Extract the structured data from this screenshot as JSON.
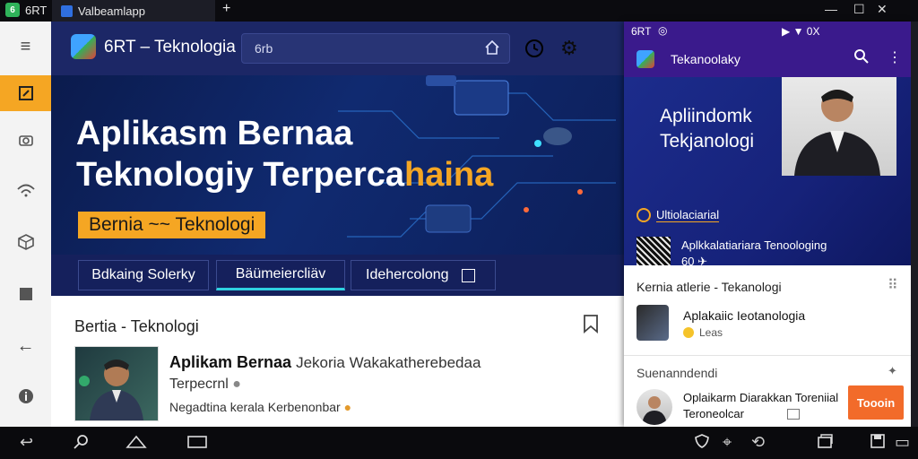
{
  "titlebar": {
    "app_label": "6RT",
    "tab_title": "Valbeamlapp",
    "new_tab": "+",
    "controls": [
      "—",
      "☐",
      "✕"
    ]
  },
  "sidebar": {
    "items": [
      {
        "icon": "menu-icon"
      },
      {
        "icon": "edit-icon",
        "active": true
      },
      {
        "icon": "camera-icon"
      },
      {
        "icon": "wifi-icon"
      },
      {
        "icon": "cube-icon"
      },
      {
        "icon": "square-icon"
      },
      {
        "icon": "back-arrow-icon"
      },
      {
        "icon": "info-icon"
      }
    ]
  },
  "main": {
    "brand": "6RT – Teknologia",
    "search_value": "6rb",
    "hero": {
      "title_line1": "Aplikasm Bernaa",
      "title_line2a": "Teknologiy Terperca",
      "title_line2b": "haina",
      "badge": "Bernia ~~ Teknologi"
    },
    "hero_tabs": [
      "Bdkaing Solerky",
      "Bäümeiercliäv",
      "Idehercolong"
    ],
    "feed": {
      "section_title": "Bertia - Teknologi",
      "article_title_bold": "Aplikam Bernaa",
      "article_title_rest": "Jekoria Wakakatherebedaa",
      "article_line2": "Terpecrnl",
      "article_line3": "Negadtina kerala Kerbenonbar"
    }
  },
  "phone": {
    "status_left": "6RT",
    "status_right": "▶ ▼ 0X",
    "app_title": "Tekanoolaky",
    "hero_title_line1": "Apliindomk",
    "hero_title_line2": "Tekjanologi",
    "hero_label": "Ultiolaciarial",
    "hero_item_title": "Aplkkalatiariara Tenoologing",
    "hero_item_meta": "60 ✈",
    "list_header": "Kernia atlerie - Tekanologi",
    "list_item1_title": "Aplakaiic Ieotanologia",
    "list_item1_meta": "Leas",
    "section2_header": "Suenanndendi",
    "list_item2_title": "Oplaikarm Diarakkan Toreniial",
    "list_item2_sub": "Teroneolcar",
    "orange_button": "Toooin"
  },
  "colors": {
    "accent": "#f5a623",
    "topbar": "#1c2766",
    "phone_bar": "#3a1a8c",
    "orange_button": "#f26b2a"
  }
}
